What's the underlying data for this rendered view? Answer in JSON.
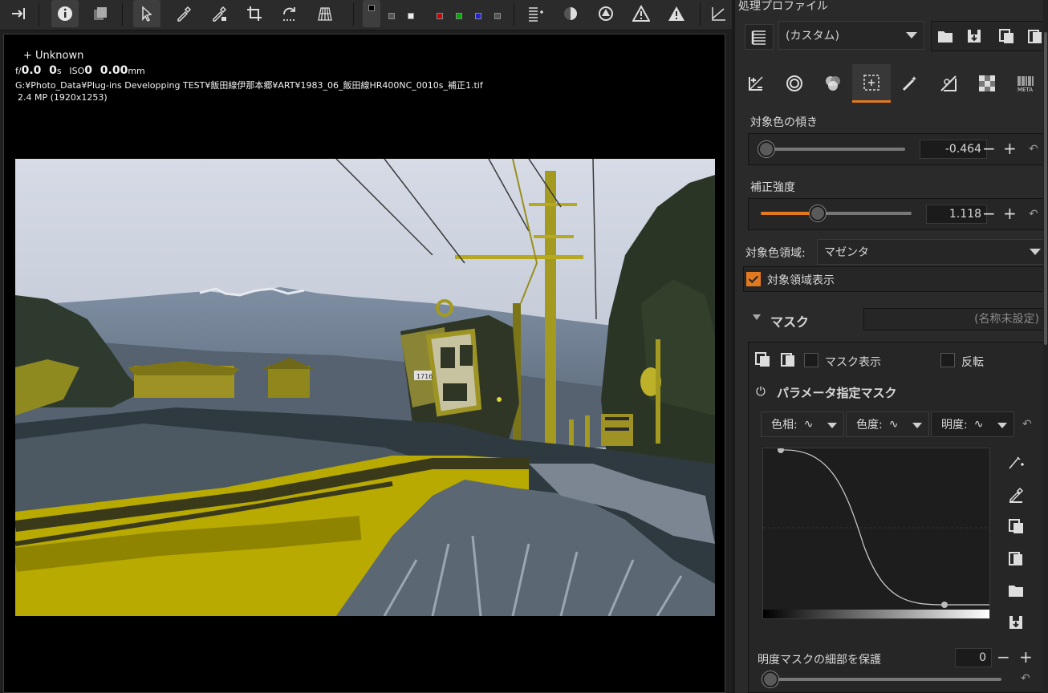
{
  "preview": {
    "camera": "+ Unknown",
    "exposure_aperture": "f/0.0",
    "exposure_shutter": "0",
    "exposure_shutter_unit": "s",
    "exposure_iso_label": "ISO",
    "exposure_iso": "0",
    "exposure_focal": "0.00",
    "exposure_focal_unit": "mm",
    "filepath": "G:¥Photo_Data¥Plug-ins Developping TEST¥飯田線伊那本郷¥ART¥1983_06_飯田線HR400NC_0010s_補正1.tif",
    "resolution": "2.4 MP (1920x1253)",
    "car_number": "1716"
  },
  "panel": {
    "title": "処理プロファイル",
    "profile_value": "(カスタム)",
    "hue_tilt_label": "対象色の傾き",
    "hue_tilt_value": "-0.464",
    "strength_label": "補正強度",
    "strength_value": "1.118",
    "color_region_label": "対象色領域:",
    "color_region_value": "マゼンタ",
    "show_region_label": "対象領域表示",
    "mask_header": "マスク",
    "mask_name_placeholder": "(名称未設定)",
    "show_mask_label": "マスク表示",
    "invert_label": "反転",
    "param_mask_label": "パラメータ指定マスク",
    "hue_btn": "色相:",
    "chroma_btn": "色度:",
    "lightness_btn": "明度:",
    "protect_label": "明度マスクの細部を保護",
    "protect_value": "0"
  },
  "levels": {
    "hue_tilt_fraction": 0.03,
    "strength_fraction": 0.38,
    "protect_fraction": 0.0
  },
  "colors": {
    "accent": "#e3791f",
    "panel_bg": "#2a2a2a",
    "highlight_yellow": "#b8aa00"
  },
  "icons": {
    "toolbar": [
      "panel-toggle-icon",
      "info-icon",
      "compare-icon",
      "pointer-icon",
      "color-picker-icon",
      "white-balance-picker-icon",
      "crop-icon",
      "rotate-icon",
      "perspective-icon",
      "chip-black-icon",
      "chip-gray-icon",
      "chip-white-icon",
      "chip-red-icon",
      "chip-green-icon",
      "chip-blue-icon",
      "chip-mono-icon",
      "histogram-icon",
      "exposure-icon",
      "focus-icon",
      "warning-shadow-icon",
      "warning-highlight-icon",
      "graph-icon"
    ],
    "tabs": [
      "exposure-tab-icon",
      "detail-tab-icon",
      "color-tab-icon",
      "local-adjust-tab-icon",
      "transform-tab-icon",
      "raw-tab-icon",
      "metadata-tab-icon"
    ]
  }
}
